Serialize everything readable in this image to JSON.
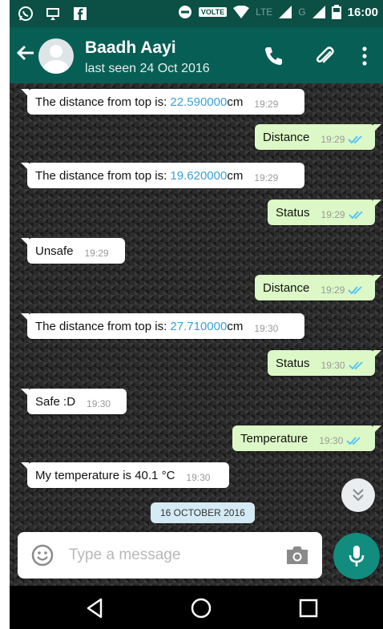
{
  "status_bar": {
    "time": "16:00",
    "volte": "VOLTE",
    "lte": "LTE",
    "g": "G"
  },
  "header": {
    "contact_name": "Baadh Aayi",
    "last_seen": "last seen 24 Oct 2016"
  },
  "messages": [
    {
      "dir": "in",
      "prefix": "The distance from top is: ",
      "value": "22.590000",
      "suffix": "cm",
      "time": "19:29"
    },
    {
      "dir": "out",
      "text": "Distance",
      "time": "19:29"
    },
    {
      "dir": "in",
      "prefix": "The distance from top is: ",
      "value": "19.620000",
      "suffix": "cm",
      "time": "19:29"
    },
    {
      "dir": "out",
      "text": "Status",
      "time": "19:29"
    },
    {
      "dir": "in",
      "text": "Unsafe",
      "time": "19:29"
    },
    {
      "dir": "out",
      "text": "Distance",
      "time": "19:29"
    },
    {
      "dir": "in",
      "prefix": "The distance from top is: ",
      "value": "27.710000",
      "suffix": "cm",
      "time": "19:30"
    },
    {
      "dir": "out",
      "text": "Status",
      "time": "19:30"
    },
    {
      "dir": "in",
      "text": "Safe :D",
      "time": "19:30"
    },
    {
      "dir": "out",
      "text": "Temperature",
      "time": "19:30"
    },
    {
      "dir": "in",
      "text": "My temperature is 40.1 °C",
      "time": "19:30"
    }
  ],
  "date_chip": "16 OCTOBER 2016",
  "composer": {
    "placeholder": "Type a message"
  },
  "colors": {
    "header": "#075e54",
    "status_bar": "#0b4f45",
    "outgoing_bubble": "#dcf8c6",
    "incoming_bubble": "#ffffff",
    "link_number": "#3aa0d8",
    "read_ticks": "#4fc3f7",
    "mic_button": "#128c7e"
  },
  "icons": {
    "back": "arrow-left-icon",
    "call": "phone-icon",
    "attach": "paperclip-icon",
    "menu": "more-vert-icon",
    "emoji": "emoji-icon",
    "camera": "camera-icon",
    "mic": "mic-icon",
    "scroll": "chevron-double-down-icon"
  }
}
